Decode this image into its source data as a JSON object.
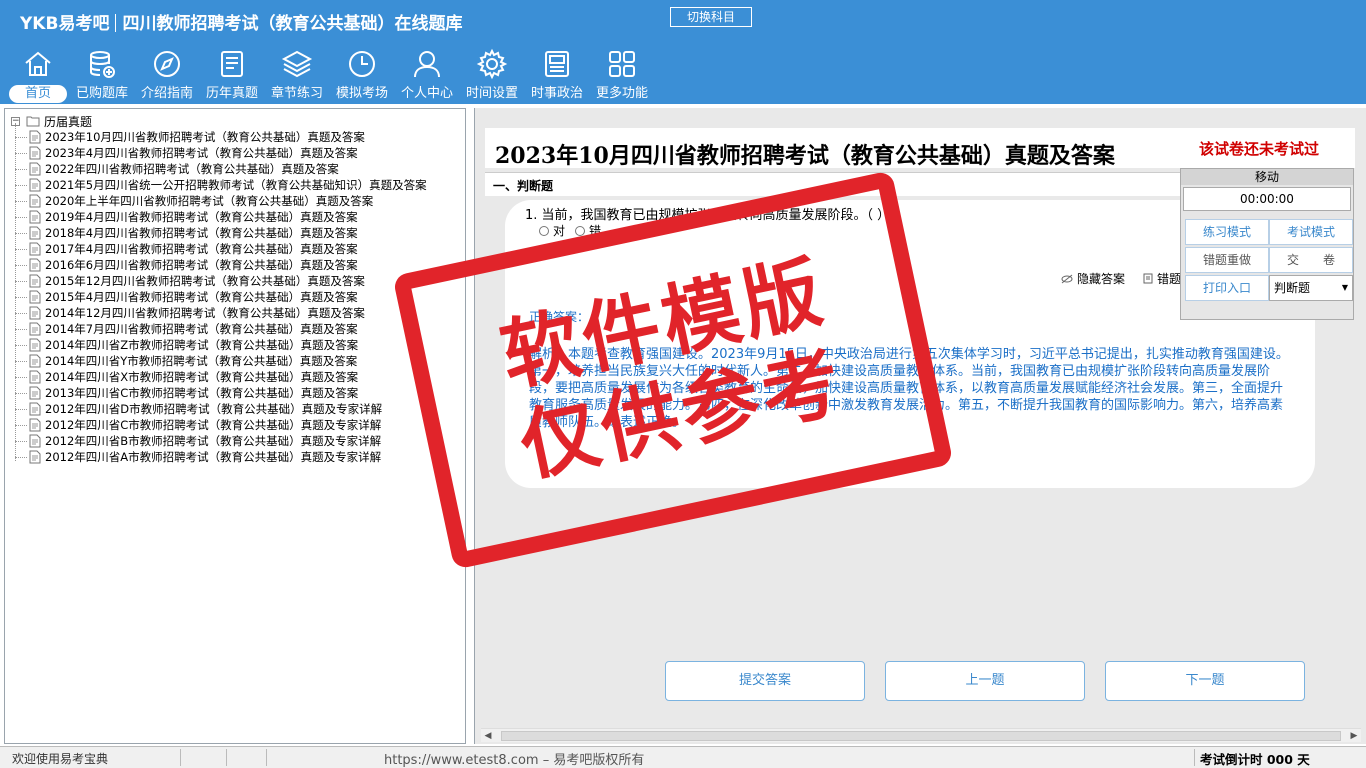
{
  "header": {
    "logo": "YKB易考吧",
    "app_title": "四川教师招聘考试（教育公共基础）在线题库",
    "switch_subject": "切换科目"
  },
  "nav": [
    {
      "label": "首页",
      "icon": "home-icon"
    },
    {
      "label": "已购题库",
      "icon": "database-icon"
    },
    {
      "label": "介绍指南",
      "icon": "compass-icon"
    },
    {
      "label": "历年真题",
      "icon": "list-icon"
    },
    {
      "label": "章节练习",
      "icon": "layers-icon"
    },
    {
      "label": "模拟考场",
      "icon": "clock-icon"
    },
    {
      "label": "个人中心",
      "icon": "user-icon"
    },
    {
      "label": "时间设置",
      "icon": "gear-icon"
    },
    {
      "label": "时事政治",
      "icon": "news-icon"
    },
    {
      "label": "更多功能",
      "icon": "grid-icon"
    }
  ],
  "tree": {
    "root": "历届真题",
    "items": [
      "2023年10月四川省教师招聘考试（教育公共基础）真题及答案",
      "2023年4月四川省教师招聘考试（教育公共基础）真题及答案",
      "2022年四川省教师招聘考试（教育公共基础）真题及答案",
      "2021年5月四川省统一公开招聘教师考试（教育公共基础知识）真题及答案",
      "2020年上半年四川省教师招聘考试（教育公共基础）真题及答案",
      "2019年4月四川省教师招聘考试（教育公共基础）真题及答案",
      "2018年4月四川省教师招聘考试（教育公共基础）真题及答案",
      "2017年4月四川省教师招聘考试（教育公共基础）真题及答案",
      "2016年6月四川省教师招聘考试（教育公共基础）真题及答案",
      "2015年12月四川省教师招聘考试（教育公共基础）真题及答案",
      "2015年4月四川省教师招聘考试（教育公共基础）真题及答案",
      "2014年12月四川省教师招聘考试（教育公共基础）真题及答案",
      "2014年7月四川省教师招聘考试（教育公共基础）真题及答案",
      "2014年四川省Z市教师招聘考试（教育公共基础）真题及答案",
      "2014年四川省Y市教师招聘考试（教育公共基础）真题及答案",
      "2014年四川省X市教师招聘考试（教育公共基础）真题及答案",
      "2013年四川省C市教师招聘考试（教育公共基础）真题及答案",
      "2012年四川省D市教师招聘考试（教育公共基础）真题及专家详解",
      "2012年四川省C市教师招聘考试（教育公共基础）真题及专家详解",
      "2012年四川省B市教师招聘考试（教育公共基础）真题及专家详解",
      "2012年四川省A市教师招聘考试（教育公共基础）真题及专家详解"
    ]
  },
  "paper": {
    "title": "2023年10月四川省教师招聘考试（教育公共基础）真题及答案",
    "status": "该试卷还未考试过",
    "section": "一、判断题",
    "question": "1. 当前，我国教育已由规模扩张阶段转向高质量发展阶段。（    ）",
    "options": [
      "对",
      "错"
    ],
    "hide_answer": "隐藏答案",
    "error_book": "错题",
    "correct_answer_label": "正确答案：",
    "explanation": "解析：本题考查教育强国建设。2023年9月15日，中央政治局进行第五次集体学习时，习近平总书记提出，扎实推动教育强国建设。第一，培养担当民族复兴大任的时代新人。第二，加快建设高质量教育体系。当前，我国教育已由规模扩张阶段转向高质量发展阶段，要把高质量发展作为各级各类教育的生命线，加快建设高质量教育体系，以教育高质量发展赋能经济社会发展。第三，全面提升教育服务高质量发展的能力。第四，在深化改革创新中激发教育发展活力。第五，不断提升我国教育的国际影响力。第六，培养高素质教师队伍。故表述正确。"
  },
  "buttons": {
    "submit": "提交答案",
    "prev": "上一题",
    "next": "下一题"
  },
  "float_panel": {
    "title": "移动",
    "timer": "00:00:00",
    "practice_mode": "练习模式",
    "exam_mode": "考试模式",
    "redo_errors": "错题重做",
    "hand_in": "交　　卷",
    "print_entry": "打印入口",
    "question_type": "判断题"
  },
  "stamp": {
    "line1": "软件模版",
    "line2": "仅供参考"
  },
  "status": {
    "welcome": "欢迎使用易考宝典",
    "copyright": "https://www.etest8.com – 易考吧版权所有",
    "countdown": "考试倒计时 000 天"
  },
  "colors": {
    "header_bg": "#3b8fd6",
    "accent_text": "#1b6fc7",
    "alert_red": "#d00000",
    "stamp_red": "#e1242a"
  }
}
